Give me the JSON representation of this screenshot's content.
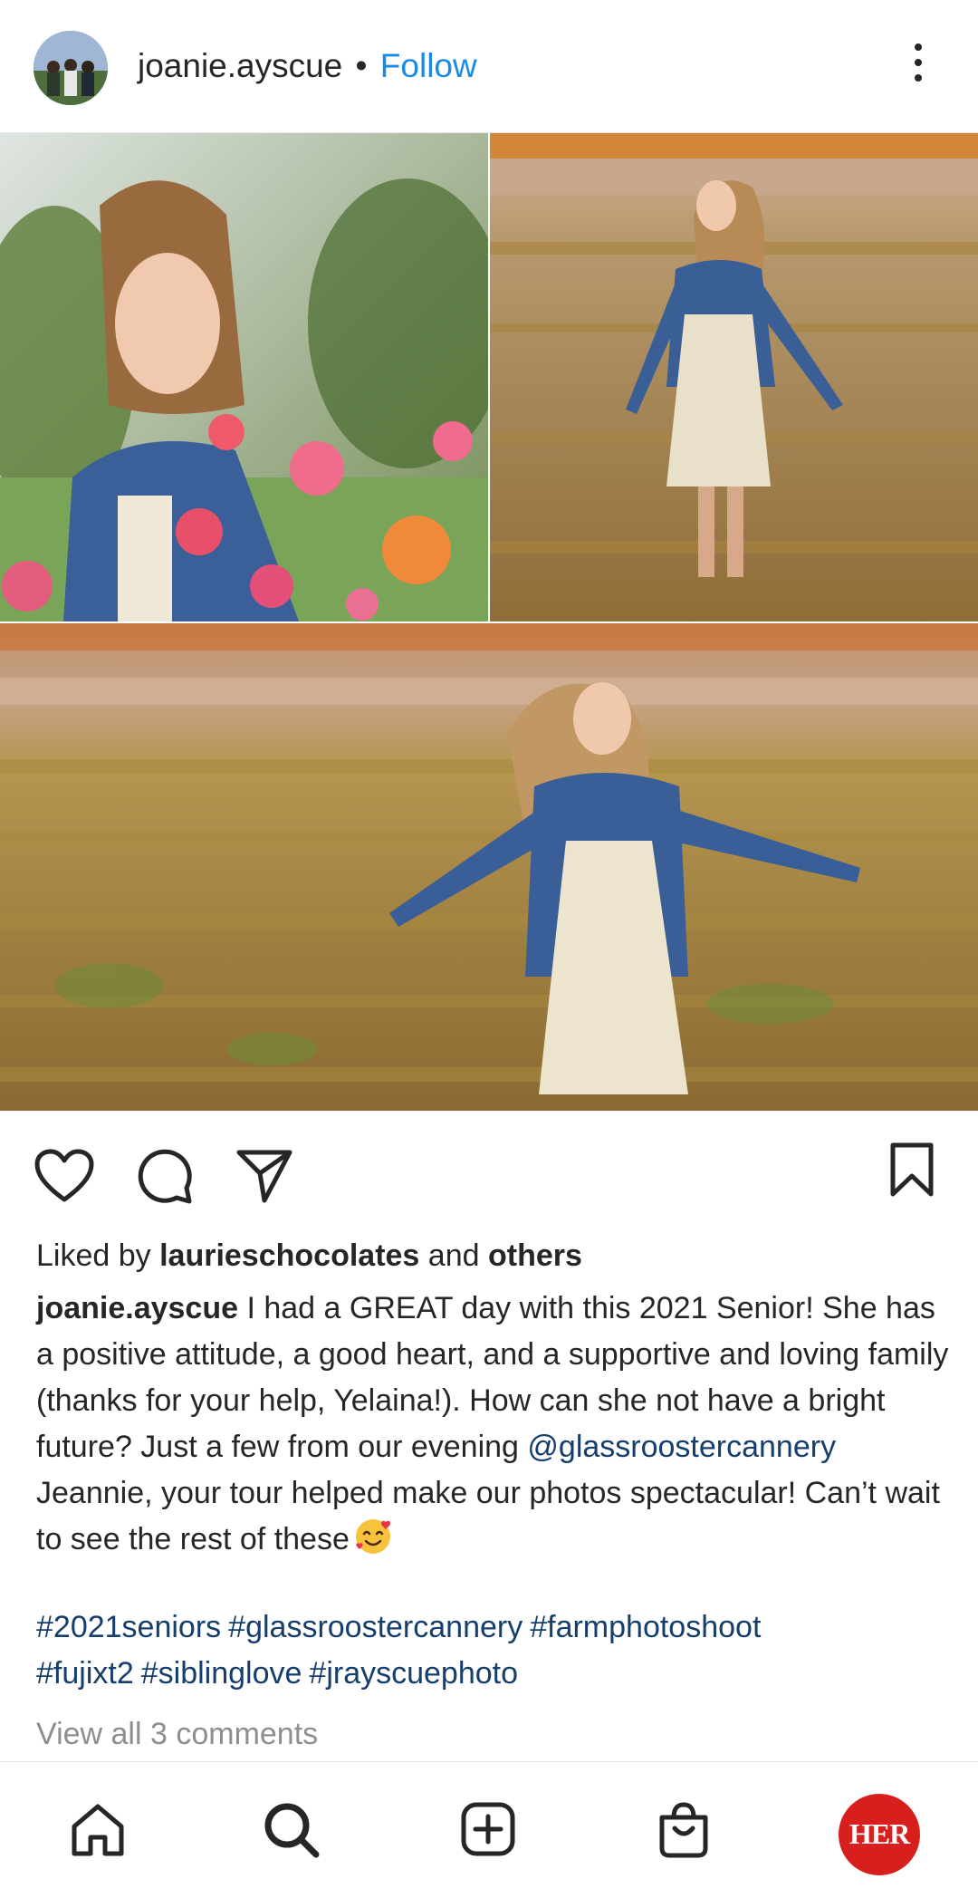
{
  "header": {
    "username": "joanie.ayscue",
    "separator": "•",
    "follow_label": "Follow",
    "avatar_icon": "profile-photo",
    "more_icon": "more-vertical-icon"
  },
  "photos": [
    {
      "name": "photo-closeup-flowers",
      "description_icon": "photo"
    },
    {
      "name": "photo-standing-field",
      "description_icon": "photo"
    },
    {
      "name": "photo-wide-field",
      "description_icon": "photo"
    }
  ],
  "actions": {
    "like_icon": "heart-icon",
    "comment_icon": "comment-icon",
    "share_icon": "send-icon",
    "save_icon": "bookmark-icon"
  },
  "likes": {
    "prefix": "Liked by",
    "user": "laurieschocolates",
    "conjunction": "and",
    "others": "others"
  },
  "caption": {
    "author": "joanie.ayscue",
    "text_part1": "I had a GREAT day with this 2021 Senior! She has a positive attitude, a good heart, and a supportive and loving family (thanks for your help, Yelaina!). How can she not have a bright future? Just a few from our evening",
    "mention": "@glassroostercannery",
    "text_part2": "Jeannie, your tour helped make our photos spectacular! Can’t wait to see the rest of these",
    "emoji_icon": "smiling-face-with-hearts-emoji"
  },
  "hashtags": [
    "#2021seniors",
    "#glassroostercannery",
    "#farmphotoshoot",
    "#fujixt2",
    "#siblinglove",
    "#jrayscuephoto"
  ],
  "comments_link": "View all 3 comments",
  "bottom_nav": {
    "items": [
      "home-icon",
      "search-icon",
      "create-icon",
      "shop-icon",
      "profile-avatar"
    ],
    "profile_logo_text": "HER",
    "brand_color": "#d7201d"
  },
  "colors": {
    "link_blue": "#1a8ae6",
    "hashtag_navy": "#163e6c",
    "muted_gray": "#8e8e8e",
    "text": "#262626"
  }
}
